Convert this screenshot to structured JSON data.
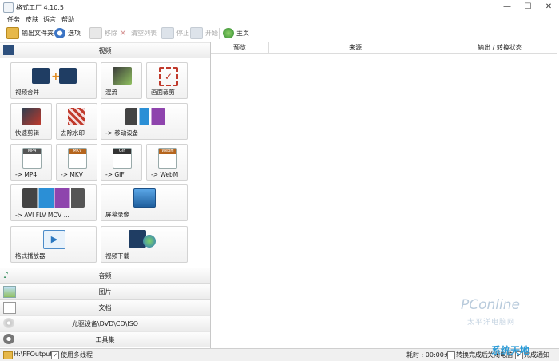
{
  "window": {
    "title": "格式工厂 4.10.5",
    "controls": [
      "—",
      "☐",
      "✕"
    ]
  },
  "menu": [
    "任务",
    "皮肤",
    "语言",
    "帮助"
  ],
  "toolbar": {
    "output_folder": "输出文件夹",
    "options": "选项",
    "remove": "移除",
    "clear_list": "清空列表",
    "stop": "停止",
    "start": "开始",
    "home": "主页"
  },
  "categories": {
    "video": "视频",
    "audio": "音频",
    "image": "图片",
    "document": "文档",
    "disc": "光驱设备\\DVD\\CD\\ISO",
    "tools": "工具集"
  },
  "tiles": [
    {
      "label": "视频合并",
      "icon": "video-merge-icon"
    },
    {
      "label": "混流",
      "icon": "mux-icon"
    },
    {
      "label": "画面裁剪",
      "icon": "crop-icon"
    },
    {
      "label": "快速剪辑",
      "icon": "quick-cut-icon"
    },
    {
      "label": "去除水印",
      "icon": "remove-watermark-icon"
    },
    {
      "label": "-> 移动设备",
      "icon": "mobile-device-icon"
    },
    {
      "label": "-> MP4",
      "icon": "mp4-icon",
      "badge": "MP4"
    },
    {
      "label": "-> MKV",
      "icon": "mkv-icon",
      "badge": "MKV"
    },
    {
      "label": "-> GIF",
      "icon": "gif-icon",
      "badge": "GIF"
    },
    {
      "label": "-> WebM",
      "icon": "webm-icon",
      "badge": "WebM"
    },
    {
      "label": "-> AVI FLV MOV ...",
      "icon": "avi-flv-mov-icon"
    },
    {
      "label": "屏幕录像",
      "icon": "screen-record-icon"
    },
    {
      "label": "格式播放器",
      "icon": "player-icon"
    },
    {
      "label": "视频下载",
      "icon": "video-download-icon"
    }
  ],
  "columns": [
    "预览",
    "来源",
    "输出 / 转换状态"
  ],
  "status": {
    "output_path": "H:\\FFOutput",
    "multithread": "使用多线程",
    "elapsed": "耗时 : 00:00:00",
    "after_finish": "转换完成后",
    "shutdown": "关闭电脑",
    "notify": "完成通知"
  },
  "watermark": {
    "brand": "PConline",
    "sub": "太平洋电脑网",
    "site": "系统天地"
  }
}
